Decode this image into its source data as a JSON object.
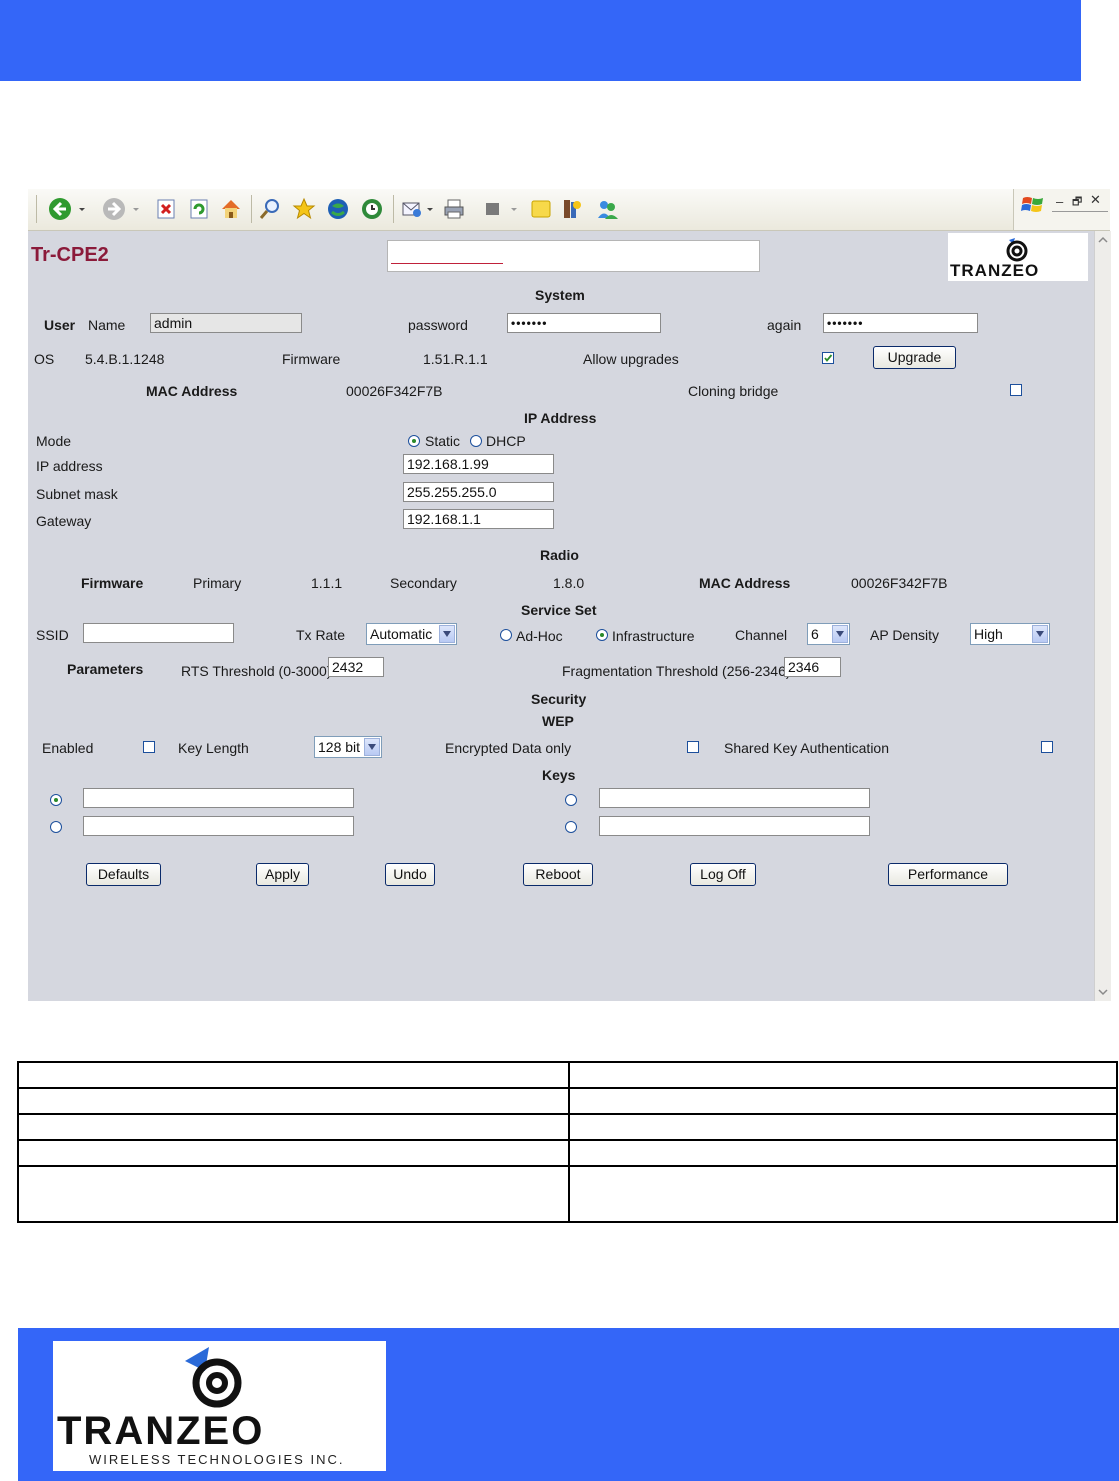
{
  "device_title": "Tr-CPE2",
  "brand_logo_text": "TRANZEO",
  "brand_logo_subtext": "WIRELESS TECHNOLOGIES INC.",
  "system": {
    "heading": "System",
    "user_label": "User",
    "name_label": "Name",
    "name_value": "admin",
    "password_label": "password",
    "password_value": "•••••••",
    "again_label": "again",
    "again_value": "•••••••",
    "os_label": "OS",
    "os_value": "5.4.B.1.1248",
    "firmware_label": "Firmware",
    "firmware_value": "1.51.R.1.1",
    "allow_upgrades_label": "Allow upgrades",
    "allow_upgrades_checked": true,
    "upgrade_button": "Upgrade",
    "mac_label": "MAC Address",
    "mac_value": "00026F342F7B",
    "cloning_bridge_label": "Cloning bridge",
    "cloning_bridge_checked": false
  },
  "ip": {
    "heading": "IP Address",
    "mode_label": "Mode",
    "mode_static": "Static",
    "mode_dhcp": "DHCP",
    "mode_selected": "Static",
    "ip_label": "IP address",
    "ip_value": "192.168.1.99",
    "subnet_label": "Subnet mask",
    "subnet_value": "255.255.255.0",
    "gateway_label": "Gateway",
    "gateway_value": "192.168.1.1"
  },
  "radio": {
    "heading": "Radio",
    "firmware_label": "Firmware",
    "primary_label": "Primary",
    "primary_value": "1.1.1",
    "secondary_label": "Secondary",
    "secondary_value": "1.8.0",
    "mac_label": "MAC Address",
    "mac_value": "00026F342F7B"
  },
  "service_set": {
    "heading": "Service Set",
    "ssid_label": "SSID",
    "ssid_value": "",
    "tx_rate_label": "Tx Rate",
    "tx_rate_value": "Automatic",
    "adhoc_label": "Ad-Hoc",
    "infrastructure_label": "Infrastructure",
    "network_mode_selected": "Infrastructure",
    "channel_label": "Channel",
    "channel_value": "6",
    "ap_density_label": "AP Density",
    "ap_density_value": "High",
    "parameters_label": "Parameters",
    "rts_label": "RTS Threshold (0-3000)",
    "rts_value": "2432",
    "frag_label": "Fragmentation Threshold (256-2346)",
    "frag_value": "2346"
  },
  "security": {
    "heading": "Security",
    "wep_heading": "WEP",
    "enabled_label": "Enabled",
    "enabled_checked": false,
    "key_length_label": "Key Length",
    "key_length_value": "128 bit",
    "encrypted_only_label": "Encrypted Data only",
    "encrypted_only_checked": false,
    "shared_key_label": "Shared Key Authentication",
    "shared_key_checked": false,
    "keys_heading": "Keys",
    "keys": [
      "",
      "",
      "",
      ""
    ],
    "selected_key": 1
  },
  "buttons": {
    "defaults": "Defaults",
    "apply": "Apply",
    "undo": "Undo",
    "reboot": "Reboot",
    "log_off": "Log Off",
    "performance": "Performance"
  },
  "colors": {
    "band_blue": "#3466f8",
    "title_maroon": "#8b1a3a",
    "panel_gray": "#d5d7df"
  }
}
